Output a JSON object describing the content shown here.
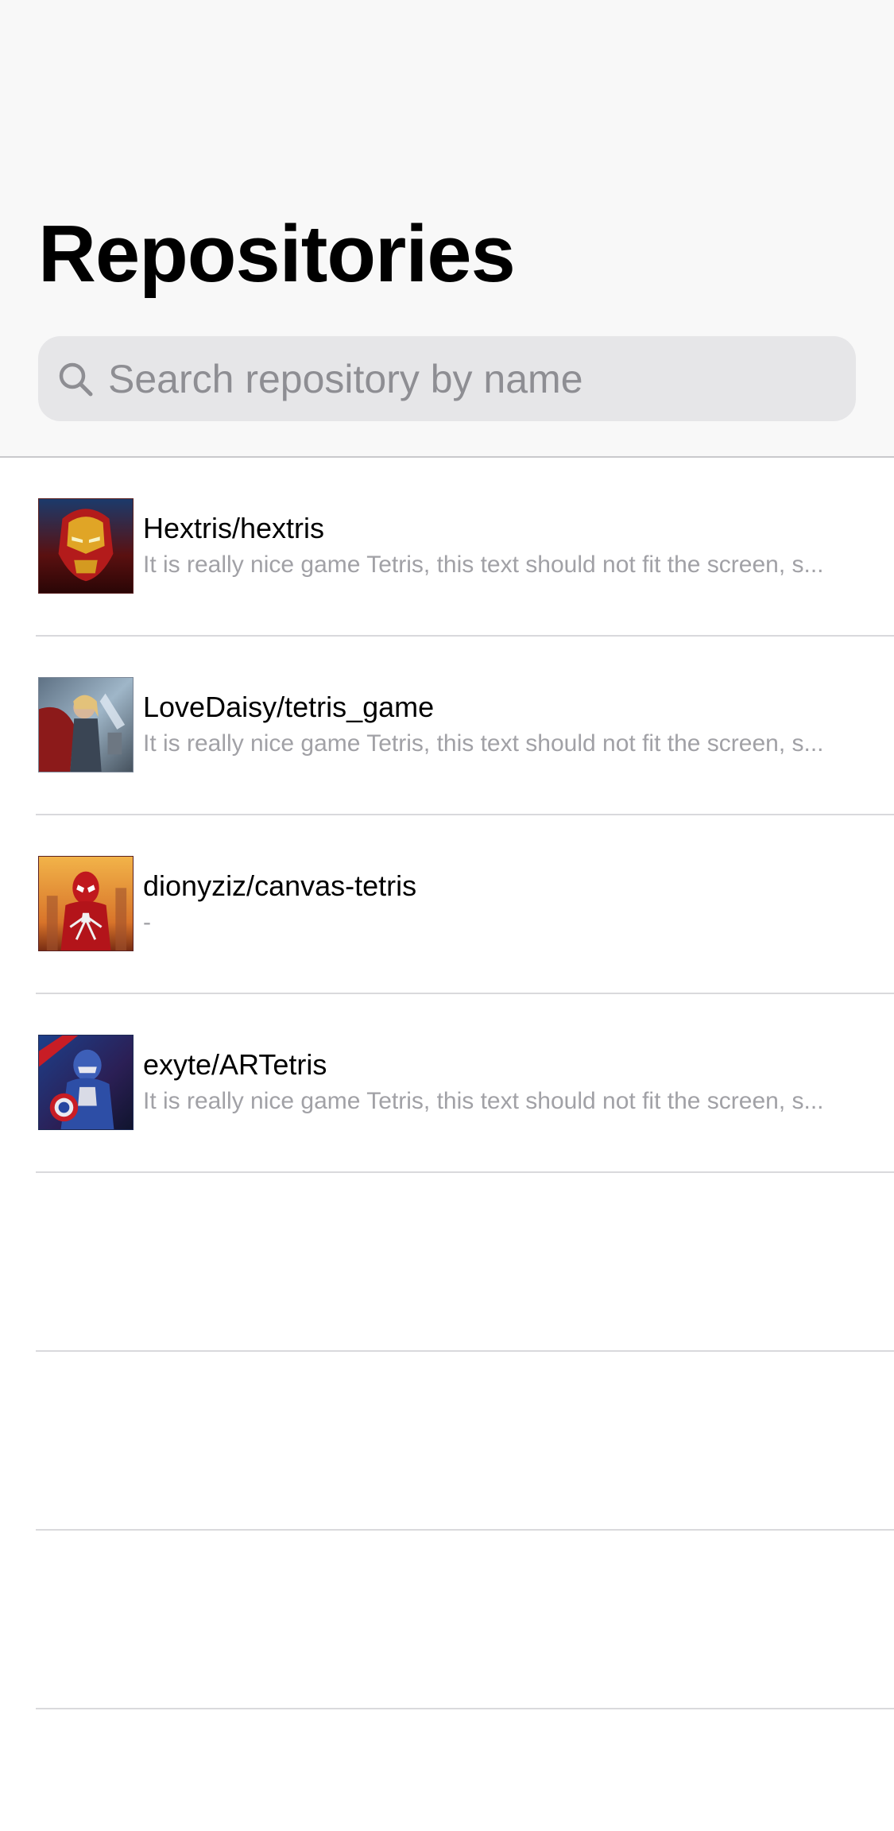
{
  "header": {
    "title": "Repositories"
  },
  "search": {
    "icon": "search-icon",
    "placeholder": "Search repository by name",
    "value": ""
  },
  "repositories": [
    {
      "name": "Hextris/hextris",
      "description": "It is really nice game Tetris, this text should not fit the screen, s...",
      "avatar_icon": "iron-man-avatar"
    },
    {
      "name": "LoveDaisy/tetris_game",
      "description": "It is really nice game Tetris, this text should not fit the screen, s...",
      "avatar_icon": "thor-avatar"
    },
    {
      "name": "dionyziz/canvas-tetris",
      "description": "-",
      "avatar_icon": "spider-man-avatar"
    },
    {
      "name": "exyte/ARTetris",
      "description": "It is really nice game Tetris, this text should not fit the screen, s...",
      "avatar_icon": "captain-america-avatar"
    }
  ],
  "colors": {
    "nav_background": "#f8f8f8",
    "search_background": "#e6e6e8",
    "placeholder": "#8e8e93",
    "description": "#a1a1a6",
    "separator": "#d9d9dc"
  }
}
